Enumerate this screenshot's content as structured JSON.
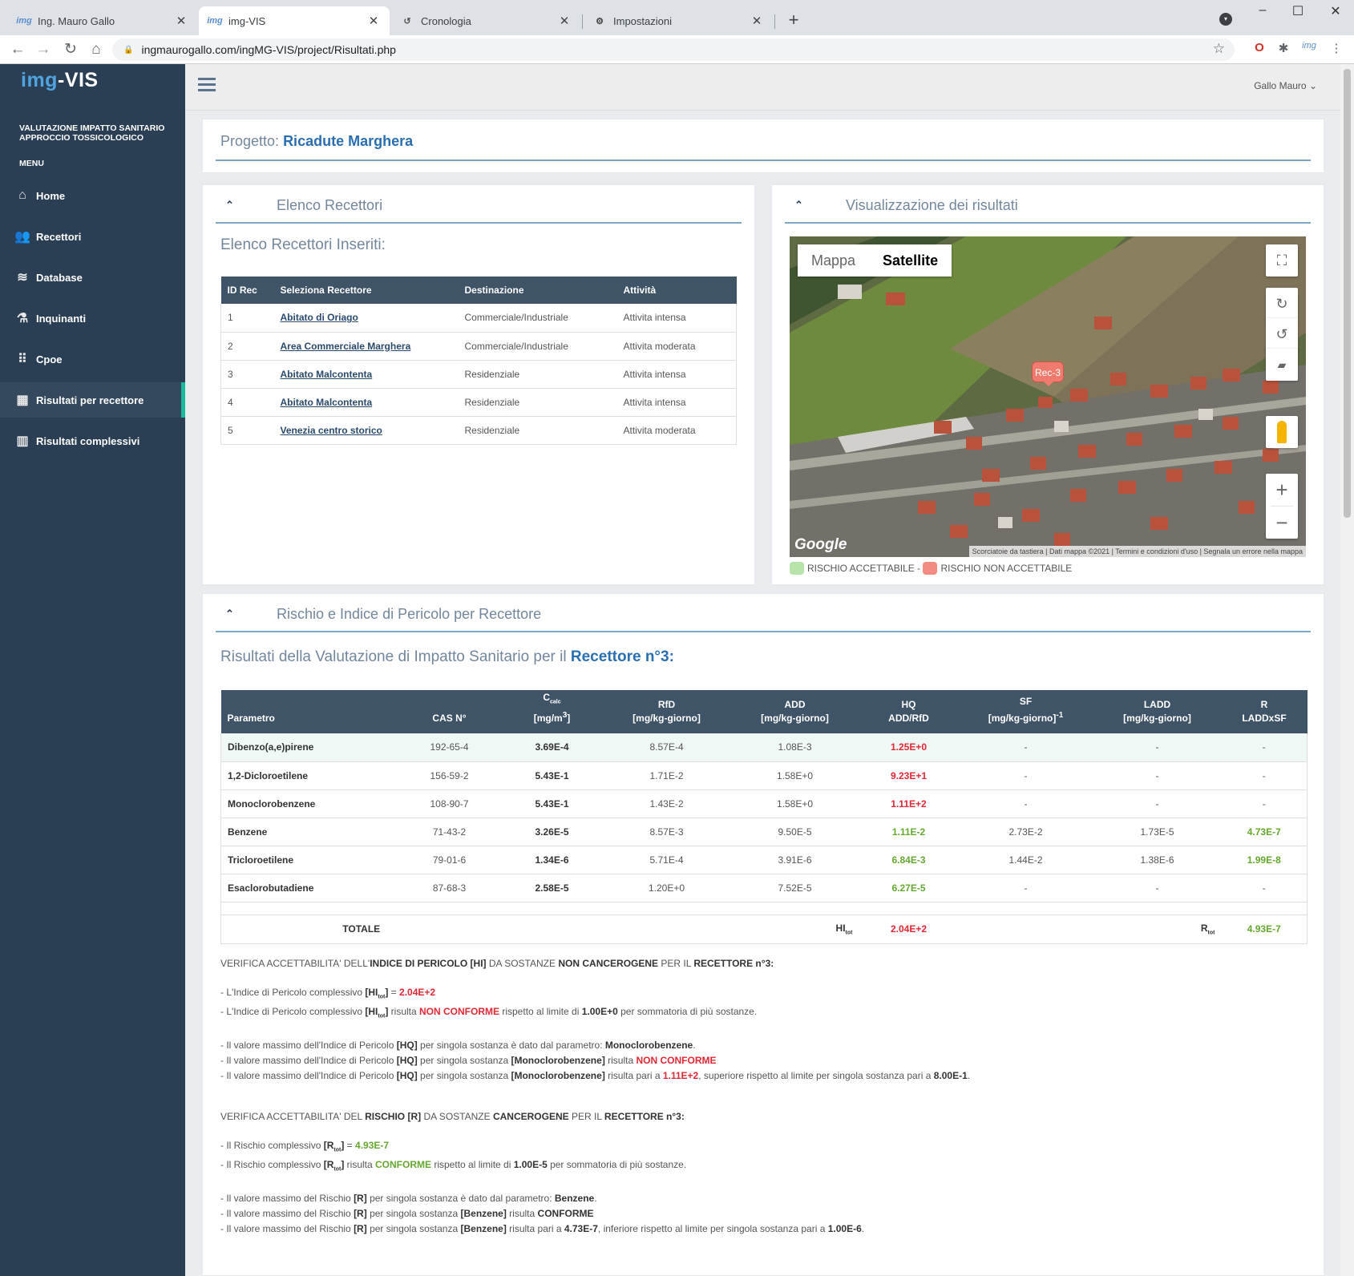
{
  "browser": {
    "tabs": [
      {
        "title": "Ing. Mauro Gallo",
        "favicon": "img"
      },
      {
        "title": "img-VIS",
        "favicon": "img"
      },
      {
        "title": "Cronologia",
        "favicon": "history-icon"
      },
      {
        "title": "Impostazioni",
        "favicon": "gear-icon"
      }
    ],
    "url": "ingmaurogallo.com/ingMG-VIS/project/Risultati.php",
    "ext_label": "img"
  },
  "sidebar": {
    "logo_a": "img",
    "logo_b": "-VIS",
    "subtitle": "VALUTAZIONE IMPATTO SANITARIO APPROCCIO TOSSICOLOGICO",
    "menu_label": "MENU",
    "items": [
      {
        "label": "Home",
        "icon": "home-icon"
      },
      {
        "label": "Recettori",
        "icon": "users-icon"
      },
      {
        "label": "Database",
        "icon": "database-icon"
      },
      {
        "label": "Inquinanti",
        "icon": "flask-icon"
      },
      {
        "label": "Cpoe",
        "icon": "grid-icon"
      },
      {
        "label": "Risultati per recettore",
        "icon": "calculator-icon"
      },
      {
        "label": "Risultati complessivi",
        "icon": "map-icon"
      }
    ]
  },
  "topnav": {
    "user": "Gallo Mauro"
  },
  "project": {
    "label": "Progetto:",
    "name": "Ricadute Marghera"
  },
  "receptors_panel": {
    "title": "Elenco Recettori",
    "subtitle": "Elenco Recettori Inseriti:",
    "headers": [
      "ID Rec",
      "Seleziona Recettore",
      "Destinazione",
      "Attività"
    ],
    "rows": [
      {
        "id": "1",
        "name": "Abitato di Oriago",
        "dest": "Commerciale/Industriale",
        "act": "Attivita intensa"
      },
      {
        "id": "2",
        "name": "Area Commerciale Marghera",
        "dest": "Commerciale/Industriale",
        "act": "Attivita moderata"
      },
      {
        "id": "3",
        "name": "Abitato Malcontenta",
        "dest": "Residenziale",
        "act": "Attivita intensa"
      },
      {
        "id": "4",
        "name": "Abitato Malcontenta",
        "dest": "Residenziale",
        "act": "Attivita intensa"
      },
      {
        "id": "5",
        "name": "Venezia centro storico",
        "dest": "Residenziale",
        "act": "Attivita moderata"
      }
    ]
  },
  "map_panel": {
    "title": "Visualizzazione dei risultati",
    "toggle": [
      "Mappa",
      "Satellite"
    ],
    "marker": "Rec-3",
    "google": "Google",
    "attribution": "Scorciatoie da tastiera | Dati mappa ©2021 | Termini e condizioni d'uso | Segnala un errore nella mappa",
    "legend_ok": "RISCHIO ACCETTABILE -",
    "legend_ko": "RISCHIO NON ACCETTABILE",
    "colors": {
      "ok": "#b7e4a8",
      "ko": "#f28b82"
    }
  },
  "risk_panel": {
    "title": "Rischio e Indice di Pericolo per Recettore",
    "subtitle_a": "Risultati della Valutazione di Impatto Sanitario per il",
    "subtitle_b": "Recettore n°3:",
    "headers": [
      {
        "l1": "",
        "l2": "Parametro"
      },
      {
        "l1": "",
        "l2": "CAS N°"
      },
      {
        "l1": "Ccalc",
        "l2": "[mg/m3]"
      },
      {
        "l1": "RfD",
        "l2": "[mg/kg-giorno]"
      },
      {
        "l1": "ADD",
        "l2": "[mg/kg-giorno]"
      },
      {
        "l1": "HQ",
        "l2": "ADD/RfD"
      },
      {
        "l1": "SF",
        "l2": "[mg/kg-giorno]-1"
      },
      {
        "l1": "LADD",
        "l2": "[mg/kg-giorno]"
      },
      {
        "l1": "R",
        "l2": "LADDxSF"
      }
    ],
    "rows": [
      {
        "p": "Dibenzo(a,e)pirene",
        "cas": "192-65-4",
        "c": "3.69E-4",
        "rfd": "8.57E-4",
        "add": "1.08E-3",
        "hq": "1.25E+0",
        "hqs": "red",
        "sf": "-",
        "ladd": "-",
        "r": "-",
        "rs": ""
      },
      {
        "p": "1,2-Dicloroetilene",
        "cas": "156-59-2",
        "c": "5.43E-1",
        "rfd": "1.71E-2",
        "add": "1.58E+0",
        "hq": "9.23E+1",
        "hqs": "red",
        "sf": "-",
        "ladd": "-",
        "r": "-",
        "rs": ""
      },
      {
        "p": "Monoclorobenzene",
        "cas": "108-90-7",
        "c": "5.43E-1",
        "rfd": "1.43E-2",
        "add": "1.58E+0",
        "hq": "1.11E+2",
        "hqs": "red",
        "sf": "-",
        "ladd": "-",
        "r": "-",
        "rs": ""
      },
      {
        "p": "Benzene",
        "cas": "71-43-2",
        "c": "3.26E-5",
        "rfd": "8.57E-3",
        "add": "9.50E-5",
        "hq": "1.11E-2",
        "hqs": "grn",
        "sf": "2.73E-2",
        "ladd": "1.73E-5",
        "r": "4.73E-7",
        "rs": "grn"
      },
      {
        "p": "Tricloroetilene",
        "cas": "79-01-6",
        "c": "1.34E-6",
        "rfd": "5.71E-4",
        "add": "3.91E-6",
        "hq": "6.84E-3",
        "hqs": "grn",
        "sf": "1.44E-2",
        "ladd": "1.38E-6",
        "r": "1.99E-8",
        "rs": "grn"
      },
      {
        "p": "Esaclorobutadiene",
        "cas": "87-68-3",
        "c": "2.58E-5",
        "rfd": "1.20E+0",
        "add": "7.52E-5",
        "hq": "6.27E-5",
        "hqs": "grn",
        "sf": "-",
        "ladd": "-",
        "r": "-",
        "rs": ""
      }
    ],
    "total": {
      "label": "TOTALE",
      "hi_label": "HItot",
      "hi": "2.04E+2",
      "r_label": "Rtot",
      "r": "4.93E-7"
    }
  },
  "verify_hi": {
    "title_a": "VERIFICA ACCETTABILITA' DELL'",
    "title_b": "INDICE DI PERICOLO [HI]",
    "title_c": "DA SOSTANZE",
    "title_d": "NON CANCEROGENE",
    "title_e": "PER IL",
    "title_f": "RECETTORE n°3:",
    "hi_value": "2.04E+2",
    "hi_status": "NON CONFORME",
    "hi_limit": "1.00E+0",
    "max_param": "Monoclorobenzene",
    "max_status": "NON CONFORME",
    "max_value": "1.11E+2",
    "max_limit": "8.00E-1"
  },
  "verify_r": {
    "title_a": "VERIFICA ACCETTABILITA' DEL",
    "title_b": "RISCHIO [R]",
    "title_c": "DA SOSTANZE",
    "title_d": "CANCEROGENE",
    "title_e": "PER IL",
    "title_f": "RECETTORE n°3:",
    "r_value": "4.93E-7",
    "r_status": "CONFORME",
    "r_limit": "1.00E-5",
    "max_param": "Benzene",
    "max_status": "CONFORME",
    "max_value": "4.73E-7",
    "max_limit": "1.00E-6"
  }
}
